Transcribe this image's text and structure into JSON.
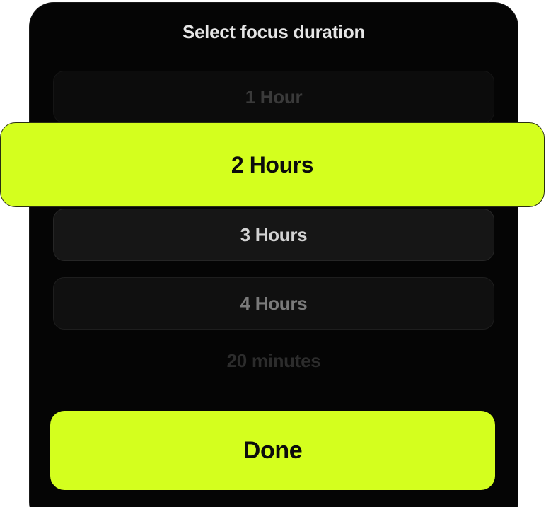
{
  "picker": {
    "title": "Select focus duration",
    "options": [
      {
        "label": "1 Hour"
      },
      {
        "label": "2 Hours"
      },
      {
        "label": "3 Hours"
      },
      {
        "label": "4 Hours"
      },
      {
        "label": "20 minutes"
      }
    ],
    "selected_label": "2 Hours"
  },
  "actions": {
    "done_label": "Done"
  },
  "colors": {
    "accent": "#d4ff1e",
    "sheet_background": "#050505",
    "selected_text": "#0c0c0c"
  }
}
